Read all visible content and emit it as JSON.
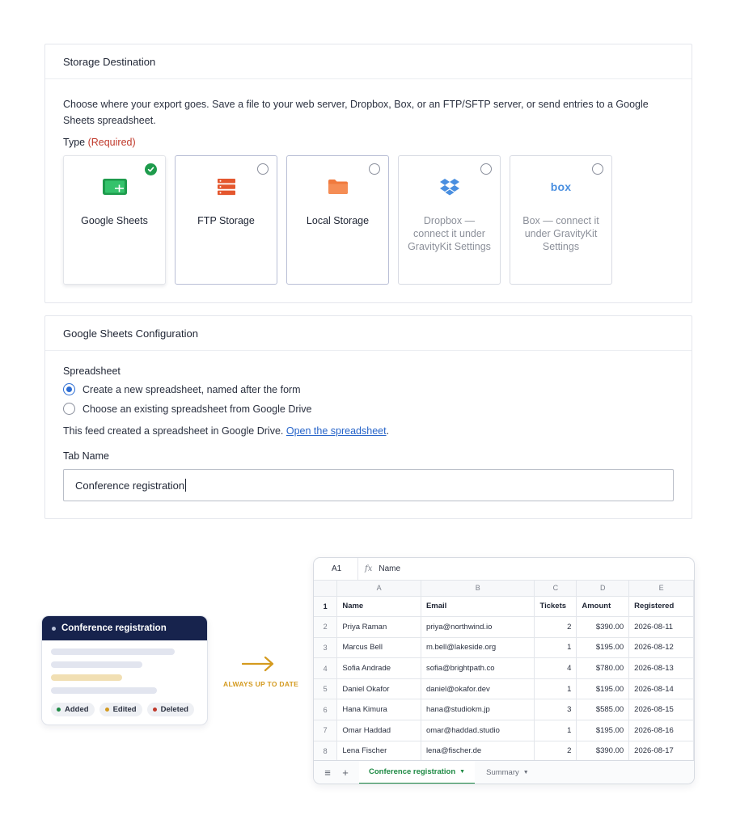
{
  "storage": {
    "title": "Storage Destination",
    "description": "Choose where your export goes. Save a file to your web server, Dropbox, Box, or an FTP/SFTP server, or send entries to a Google Sheets spreadsheet.",
    "type_label": "Type",
    "required_label": "(Required)",
    "options": [
      {
        "label": "Google Sheets",
        "state": "selected",
        "icon": "google-sheets-icon"
      },
      {
        "label": "FTP Storage",
        "state": "unselected",
        "icon": "server-icon"
      },
      {
        "label": "Local Storage",
        "state": "unselected",
        "icon": "folder-icon"
      },
      {
        "label": "Dropbox — connect it under GravityKit Settings",
        "state": "disabled",
        "icon": "dropbox-icon"
      },
      {
        "label": "Box — connect it under GravityKit Settings",
        "state": "disabled",
        "icon": "box-icon",
        "logo_text": "box"
      }
    ]
  },
  "sheets_config": {
    "title": "Google Sheets Configuration",
    "spreadsheet_label": "Spreadsheet",
    "radio_new": "Create a new spreadsheet, named after the form",
    "radio_existing": "Choose an existing spreadsheet from Google Drive",
    "selected_radio": "new",
    "info_text": "This feed created a spreadsheet in Google Drive.",
    "info_link": "Open the spreadsheet",
    "info_suffix": ".",
    "tab_name_label": "Tab Name",
    "tab_name_value": "Conference registration"
  },
  "mini_card": {
    "title": "Conference registration",
    "legend": [
      {
        "label": "Added",
        "color": "#1e8a44"
      },
      {
        "label": "Edited",
        "color": "#d49a1f"
      },
      {
        "label": "Deleted",
        "color": "#c0392b"
      }
    ]
  },
  "connector": {
    "label": "ALWAYS UP TO DATE",
    "color": "#d49a1f"
  },
  "spreadsheet": {
    "cell_ref": "A1",
    "fx": "fx",
    "formula": "Name",
    "columns": [
      "A",
      "B",
      "C",
      "D",
      "E"
    ],
    "headers": [
      "Name",
      "Email",
      "Tickets",
      "Amount",
      "Registered"
    ],
    "rows": [
      [
        "Priya Raman",
        "priya@northwind.io",
        "2",
        "$390.00",
        "2026-08-11"
      ],
      [
        "Marcus Bell",
        "m.bell@lakeside.org",
        "1",
        "$195.00",
        "2026-08-12"
      ],
      [
        "Sofia Andrade",
        "sofia@brightpath.co",
        "4",
        "$780.00",
        "2026-08-13"
      ],
      [
        "Daniel Okafor",
        "daniel@okafor.dev",
        "1",
        "$195.00",
        "2026-08-14"
      ],
      [
        "Hana Kimura",
        "hana@studiokm.jp",
        "3",
        "$585.00",
        "2026-08-15"
      ],
      [
        "Omar Haddad",
        "omar@haddad.studio",
        "1",
        "$195.00",
        "2026-08-16"
      ],
      [
        "Lena Fischer",
        "lena@fischer.de",
        "2",
        "$390.00",
        "2026-08-17"
      ]
    ],
    "tabs": [
      {
        "label": "Conference registration",
        "active": true
      },
      {
        "label": "Summary",
        "active": false
      }
    ],
    "menu_glyph": "≡",
    "add_glyph": "+",
    "dropdown_glyph": "▼"
  }
}
